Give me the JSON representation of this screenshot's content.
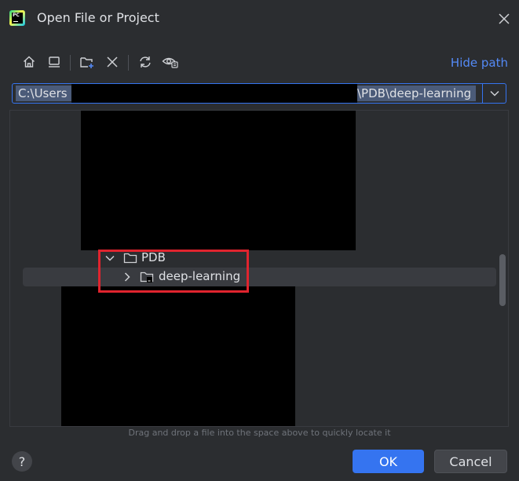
{
  "window": {
    "title": "Open File or Project",
    "app_icon_text": "PC"
  },
  "toolbar": {
    "buttons": [
      {
        "name": "home-icon"
      },
      {
        "name": "desktop-icon"
      },
      {
        "name": "new-folder-icon"
      },
      {
        "name": "delete-icon"
      },
      {
        "name": "refresh-icon"
      },
      {
        "name": "show-hidden-icon"
      }
    ],
    "hide_path_label": "Hide path"
  },
  "path": {
    "prefix": "C:\\Users",
    "suffix": "\\PDB\\deep-learning"
  },
  "tree": {
    "items": [
      {
        "label": "PDB",
        "expanded": true
      },
      {
        "label": "deep-learning",
        "expanded": false,
        "selected": true
      }
    ]
  },
  "hint": "Drag and drop a file into the space above to quickly locate it",
  "buttons": {
    "help": "?",
    "ok": "OK",
    "cancel": "Cancel"
  },
  "colors": {
    "background": "#2b2d30",
    "accent": "#3574f0",
    "link": "#548af7",
    "highlight": "#e0242e"
  }
}
